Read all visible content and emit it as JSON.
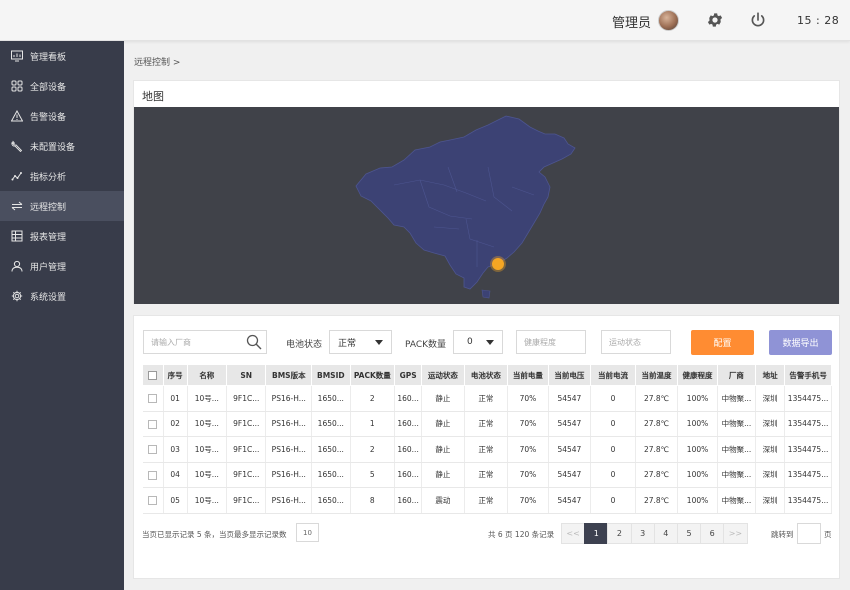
{
  "header": {
    "user_name": "管理员",
    "time": "15 : 28"
  },
  "sidebar": {
    "items": [
      {
        "label": "管理看板",
        "icon": "dashboard-icon"
      },
      {
        "label": "全部设备",
        "icon": "grid-icon"
      },
      {
        "label": "告警设备",
        "icon": "warning-icon"
      },
      {
        "label": "未配置设备",
        "icon": "wrench-icon"
      },
      {
        "label": "指标分析",
        "icon": "trend-icon"
      },
      {
        "label": "远程控制",
        "icon": "transfer-icon",
        "active": true
      },
      {
        "label": "报表管理",
        "icon": "table-icon"
      },
      {
        "label": "用户管理",
        "icon": "user-icon"
      },
      {
        "label": "系统设置",
        "icon": "gear-icon"
      }
    ]
  },
  "breadcrumb": "远程控制 >",
  "map": {
    "title": "地图",
    "background": "#404249",
    "region_color": "#3c4274",
    "marker_color": "#f5a623"
  },
  "filters": {
    "vendor_placeholder": "请输入厂商",
    "battery_status_label": "电池状态",
    "battery_status_value": "正常",
    "pack_count_label": "PACK数量",
    "pack_count_value": "0",
    "health_placeholder": "健康程度",
    "motion_placeholder": "运动状态",
    "config_button": "配置",
    "export_button": "数据导出"
  },
  "table": {
    "columns": [
      "序号",
      "名称",
      "SN",
      "BMS版本",
      "BMSID",
      "PACK数量",
      "GPS",
      "运动状态",
      "电池状态",
      "当前电量",
      "当前电压",
      "当前电流",
      "当前温度",
      "健康程度",
      "厂商",
      "地址",
      "告警手机号"
    ],
    "rows": [
      [
        "01",
        "10号...",
        "9F1C...",
        "PS16-H...",
        "1650...",
        "2",
        "160...",
        "静止",
        "正常",
        "70%",
        "54547",
        "0",
        "27.8℃",
        "100%",
        "中物聚...",
        "深圳",
        "1354475..."
      ],
      [
        "02",
        "10号...",
        "9F1C...",
        "PS16-H...",
        "1650...",
        "1",
        "160...",
        "静止",
        "正常",
        "70%",
        "54547",
        "0",
        "27.8℃",
        "100%",
        "中物聚...",
        "深圳",
        "1354475..."
      ],
      [
        "03",
        "10号...",
        "9F1C...",
        "PS16-H...",
        "1650...",
        "2",
        "160...",
        "静止",
        "正常",
        "70%",
        "54547",
        "0",
        "27.8℃",
        "100%",
        "中物聚...",
        "深圳",
        "1354475..."
      ],
      [
        "04",
        "10号...",
        "9F1C...",
        "PS16-H...",
        "1650...",
        "5",
        "160...",
        "静止",
        "正常",
        "70%",
        "54547",
        "0",
        "27.8℃",
        "100%",
        "中物聚...",
        "深圳",
        "1354475..."
      ],
      [
        "05",
        "10号...",
        "9F1C...",
        "PS16-H...",
        "1650...",
        "8",
        "160...",
        "震动",
        "正常",
        "70%",
        "54547",
        "0",
        "27.8℃",
        "100%",
        "中物聚...",
        "深圳",
        "1354475..."
      ]
    ]
  },
  "footer": {
    "page_info": "当页已显示记录 5 条，当页最多显示记录数",
    "page_size": "10",
    "total_info": "共 6 页 120 条记录",
    "prev": "<<",
    "pages": [
      "1",
      "2",
      "3",
      "4",
      "5",
      "6"
    ],
    "current_page": "1",
    "next": ">>",
    "jump_label": "跳转到",
    "jump_suffix": "页"
  }
}
